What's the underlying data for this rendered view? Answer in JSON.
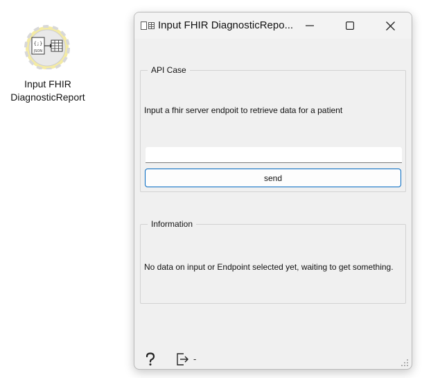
{
  "node": {
    "label_line1": "Input FHIR",
    "label_line2": "DiagnosticReport",
    "icon": "json-to-table-icon"
  },
  "window": {
    "title": "Input FHIR DiagnosticRepo...",
    "buttons": {
      "minimize": "minimize-icon",
      "maximize": "maximize-icon",
      "close": "close-icon"
    }
  },
  "api_case": {
    "title": "API Case",
    "description": "Input a fhir server endpoit to retrieve data for a patient",
    "endpoint_value": "",
    "send_label": "send"
  },
  "information": {
    "title": "Information",
    "message": "No data on input or Endpoint selected yet, waiting to get something."
  },
  "footer": {
    "help_icon": "help-icon",
    "output_icon": "output-icon",
    "output_text": "-"
  },
  "colors": {
    "accent": "#0067c0",
    "window_bg": "#f0f0f0",
    "node_ring": "#f2e89a"
  }
}
